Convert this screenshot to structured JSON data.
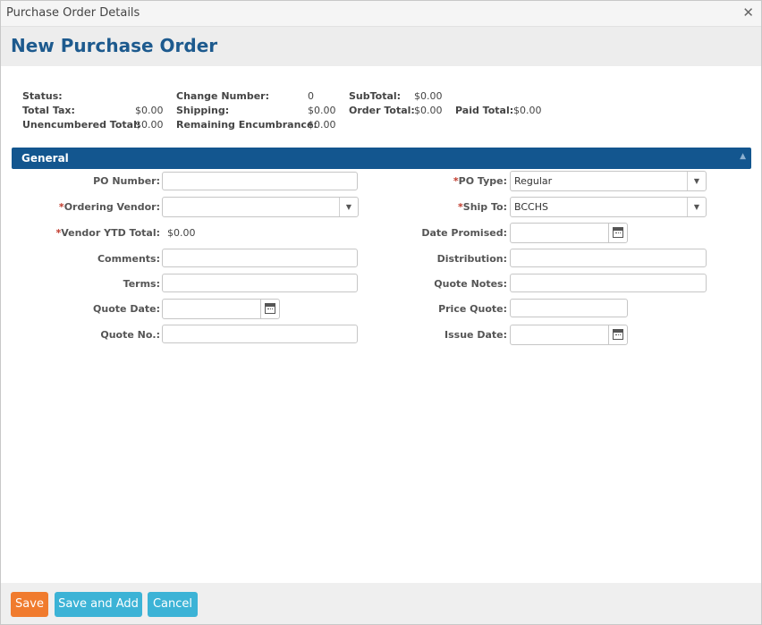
{
  "window": {
    "title": "Purchase Order Details"
  },
  "page": {
    "title": "New Purchase Order"
  },
  "summary": {
    "status_label": "Status:",
    "total_tax_label": "Total Tax:",
    "total_tax": "$0.00",
    "unencumbered_label": "Unencumbered Total:",
    "unencumbered": "$0.00",
    "change_number_label": "Change Number:",
    "change_number": "0",
    "shipping_label": "Shipping:",
    "shipping": "$0.00",
    "remaining_label": "Remaining Encumbrance:",
    "remaining": "$0.00",
    "subtotal_label": "SubTotal:",
    "subtotal": "$0.00",
    "order_total_label": "Order Total:",
    "order_total": "$0.00",
    "paid_total_label": "Paid Total:",
    "paid_total": "$0.00"
  },
  "section": {
    "title": "General",
    "collapse_icon": "collapse-up-icon"
  },
  "form": {
    "left": {
      "po_number": {
        "label": "PO Number:",
        "value": ""
      },
      "ordering_vendor": {
        "required": "*",
        "label": "Ordering Vendor:",
        "value": ""
      },
      "vendor_ytd": {
        "required": "*",
        "label": "Vendor YTD Total:",
        "value": "$0.00"
      },
      "comments": {
        "label": "Comments:",
        "value": ""
      },
      "terms": {
        "label": "Terms:",
        "value": ""
      },
      "quote_date": {
        "label": "Quote Date:",
        "value": ""
      },
      "quote_no": {
        "label": "Quote No.:",
        "value": ""
      }
    },
    "right": {
      "po_type": {
        "required": "*",
        "label": "PO Type:",
        "value": "Regular"
      },
      "ship_to": {
        "required": "*",
        "label": "Ship To:",
        "value": "BCCHS"
      },
      "date_promised": {
        "label": "Date Promised:",
        "value": ""
      },
      "distribution": {
        "label": "Distribution:",
        "value": ""
      },
      "quote_notes": {
        "label": "Quote Notes:",
        "value": ""
      },
      "price_quote": {
        "label": "Price Quote:",
        "value": ""
      },
      "issue_date": {
        "label": "Issue Date:",
        "value": ""
      }
    }
  },
  "buttons": {
    "save": "Save",
    "save_and_add": "Save and Add",
    "cancel": "Cancel"
  },
  "colors": {
    "accent": "#1d5a8e",
    "section_bar": "#13568f",
    "save_button": "#f07b2e",
    "secondary_button": "#3cb3d6",
    "required": "#c0392b"
  }
}
